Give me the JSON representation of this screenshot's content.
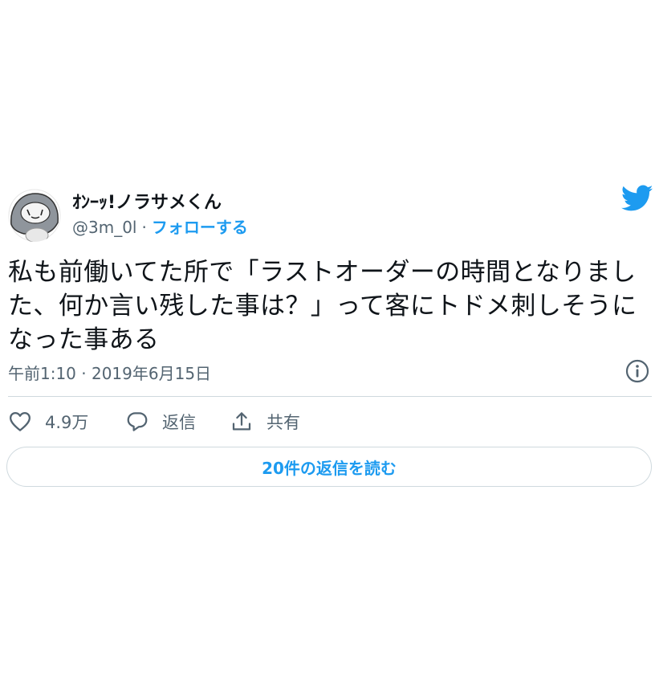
{
  "author": {
    "display_name": "ｵﾝｰｯ!ノラサメくん",
    "handle": "@3m_0l",
    "separator": "·",
    "follow_label": "フォローする"
  },
  "tweet": {
    "text": "私も前働いてた所で「ラストオーダーの時間となりました、何か言い残した事は？」って客にトドメ刺しそうになった事ある",
    "timestamp": "午前1:10 · 2019年6月15日"
  },
  "actions": {
    "like_count": "4.9万",
    "reply_label": "返信",
    "share_label": "共有"
  },
  "replies_button_label": "20件の返信を読む",
  "icons": {
    "brand": "twitter-bird-icon",
    "info": "info-icon",
    "like": "heart-icon",
    "reply": "speech-bubble-icon",
    "share": "share-icon"
  },
  "colors": {
    "accent": "#1d9bf0",
    "text": "#0f1419",
    "secondary_text": "#536471",
    "border": "#cfd9de"
  }
}
